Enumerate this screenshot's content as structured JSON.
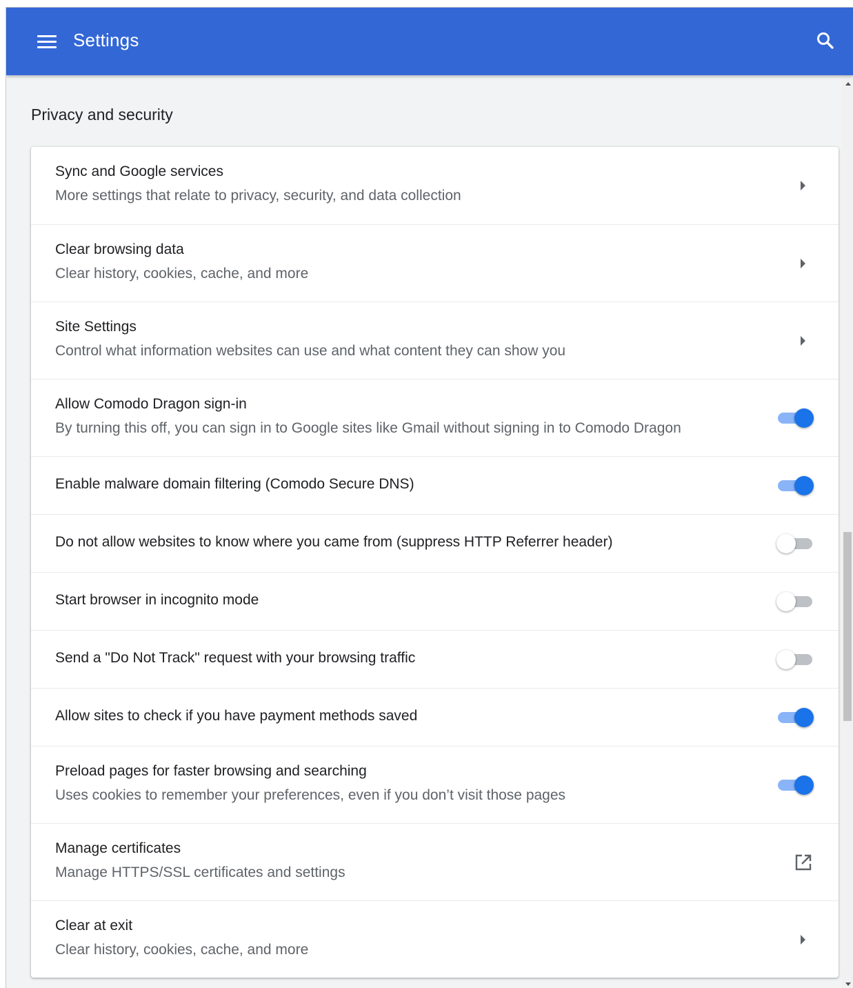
{
  "header": {
    "title": "Settings",
    "menu_icon": "hamburger-menu-icon",
    "search_icon": "search-icon",
    "color": "#3367d6"
  },
  "section": {
    "title": "Privacy and security"
  },
  "rows": [
    {
      "label": "Sync and Google services",
      "sublabel": "More settings that relate to privacy, security, and data collection",
      "control": "arrow"
    },
    {
      "label": "Clear browsing data",
      "sublabel": "Clear history, cookies, cache, and more",
      "control": "arrow"
    },
    {
      "label": "Site Settings",
      "sublabel": "Control what information websites can use and what content they can show you",
      "control": "arrow"
    },
    {
      "label": "Allow Comodo Dragon sign-in",
      "sublabel": "By turning this off, you can sign in to Google sites like Gmail without signing in to Comodo Dragon",
      "control": "toggle",
      "on": true
    },
    {
      "label": "Enable malware domain filtering (Comodo Secure DNS)",
      "control": "toggle",
      "on": true
    },
    {
      "label": "Do not allow websites to know where you came from (suppress HTTP Referrer header)",
      "control": "toggle",
      "on": false
    },
    {
      "label": "Start browser in incognito mode",
      "control": "toggle",
      "on": false
    },
    {
      "label": "Send a \"Do Not Track\" request with your browsing traffic",
      "control": "toggle",
      "on": false
    },
    {
      "label": "Allow sites to check if you have payment methods saved",
      "control": "toggle",
      "on": true
    },
    {
      "label": "Preload pages for faster browsing and searching",
      "sublabel": "Uses cookies to remember your preferences, even if you don’t visit those pages",
      "control": "toggle",
      "on": true
    },
    {
      "label": "Manage certificates",
      "sublabel": "Manage HTTPS/SSL certificates and settings",
      "control": "external-link"
    },
    {
      "label": "Clear at exit",
      "sublabel": "Clear history, cookies, cache, and more",
      "control": "arrow"
    }
  ],
  "colors": {
    "accent": "#1a73e8",
    "toggle_track_on": "#8ab4f8",
    "toggle_track_off": "#bdc1c6"
  }
}
